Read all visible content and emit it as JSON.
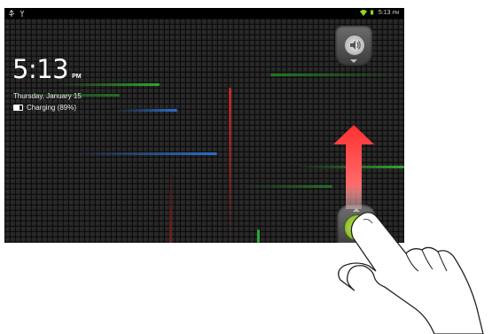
{
  "status_bar": {
    "time": "5:13",
    "ampm": "PM",
    "left_icons": [
      "usb-icon",
      "debug-icon"
    ],
    "right_icons": [
      "wifi-icon",
      "battery-icon"
    ]
  },
  "lockscreen": {
    "clock_time": "5:13",
    "clock_ampm": "PM",
    "date": "Thursday, January 15",
    "charging": "Charging (89%)"
  },
  "controls": {
    "sound_toggle_icon": "speaker-icon",
    "unlock_icon": "padlock-icon",
    "swipe_direction": "up"
  },
  "colors": {
    "accent_green": "#8fd42b",
    "arrow_red": "#ff3a3a",
    "streak_green": "#2ea82e",
    "streak_blue": "#2a6fd1",
    "streak_red": "#c22a2a"
  }
}
